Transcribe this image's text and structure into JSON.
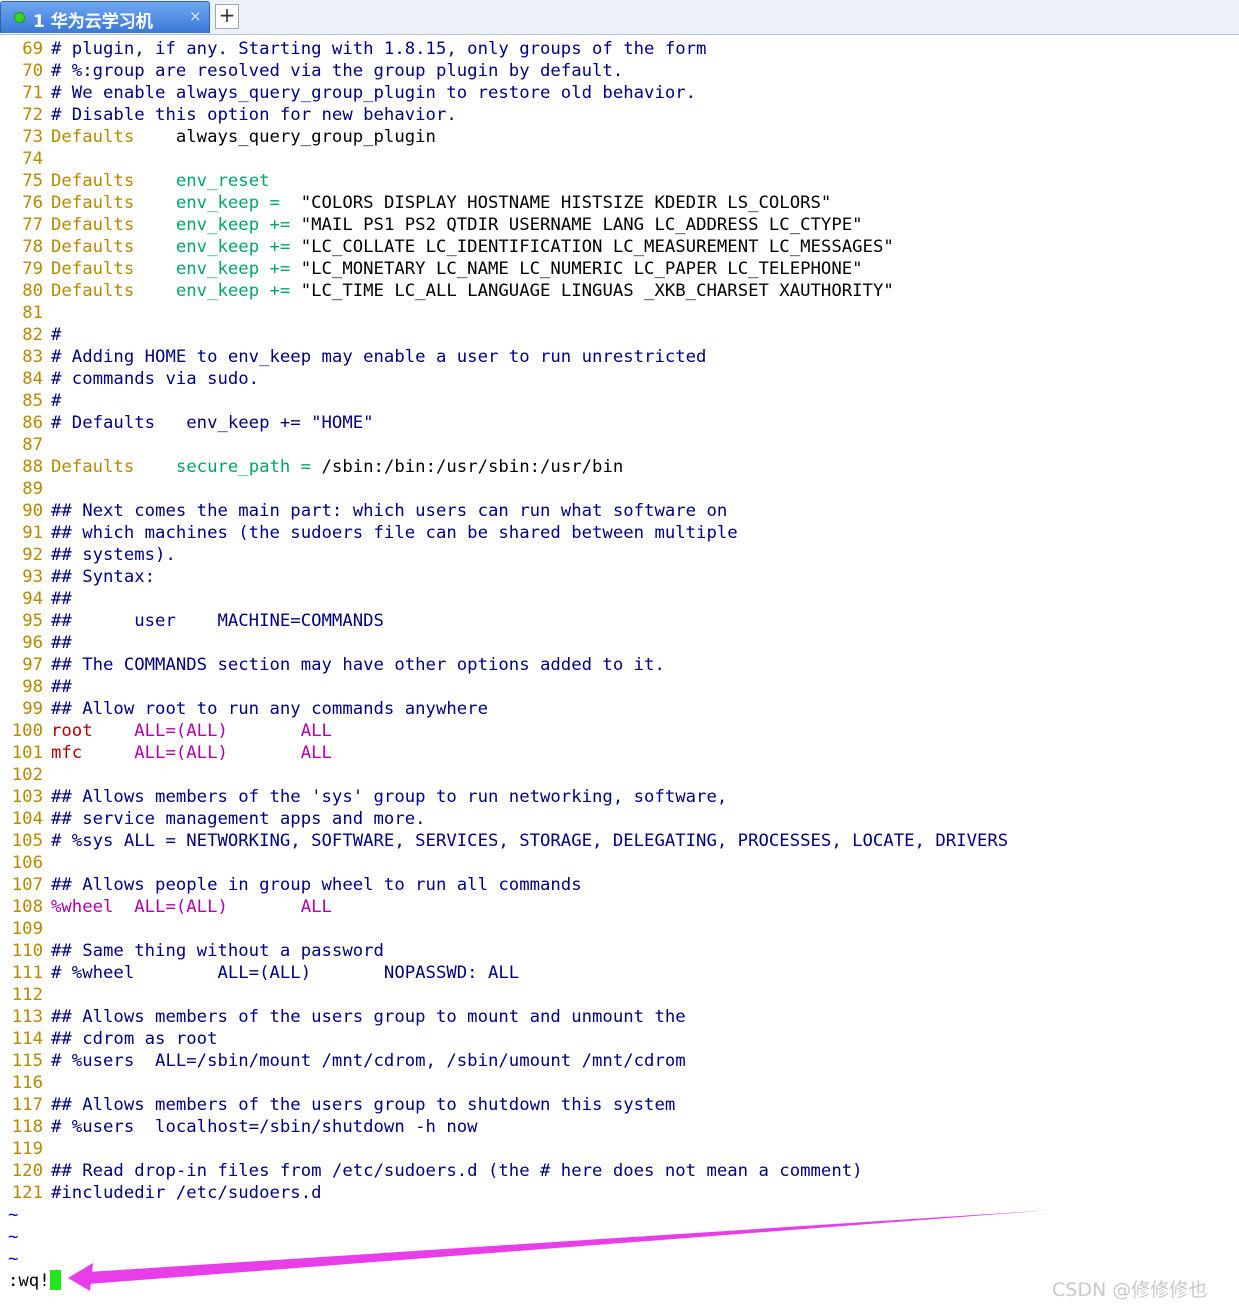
{
  "tab": {
    "title": "1 华为云学习机",
    "close_glyph": "×",
    "new_glyph": "+",
    "status_color": "#35d81f"
  },
  "editor": {
    "lines": [
      {
        "n": "69",
        "segs": [
          {
            "s": "c",
            "t": "# plugin, if any. Starting with 1.8.15, only groups of the form"
          }
        ]
      },
      {
        "n": "70",
        "segs": [
          {
            "s": "c",
            "t": "# %:group are resolved via the group plugin by default."
          }
        ]
      },
      {
        "n": "71",
        "segs": [
          {
            "s": "c",
            "t": "# We enable always_query_group_plugin to restore old behavior."
          }
        ]
      },
      {
        "n": "72",
        "segs": [
          {
            "s": "c",
            "t": "# Disable this option for new behavior."
          }
        ]
      },
      {
        "n": "73",
        "segs": [
          {
            "s": "k",
            "t": "Defaults"
          },
          {
            "s": "t",
            "t": "    always_query_group_plugin"
          }
        ]
      },
      {
        "n": "74",
        "segs": []
      },
      {
        "n": "75",
        "segs": [
          {
            "s": "k",
            "t": "Defaults"
          },
          {
            "s": "t",
            "t": "    "
          },
          {
            "s": "g",
            "t": "env_reset"
          }
        ]
      },
      {
        "n": "76",
        "segs": [
          {
            "s": "k",
            "t": "Defaults"
          },
          {
            "s": "t",
            "t": "    "
          },
          {
            "s": "g",
            "t": "env_keep =  "
          },
          {
            "s": "s",
            "t": "\"COLORS DISPLAY HOSTNAME HISTSIZE KDEDIR LS_COLORS\""
          }
        ]
      },
      {
        "n": "77",
        "segs": [
          {
            "s": "k",
            "t": "Defaults"
          },
          {
            "s": "t",
            "t": "    "
          },
          {
            "s": "g",
            "t": "env_keep += "
          },
          {
            "s": "s",
            "t": "\"MAIL PS1 PS2 QTDIR USERNAME LANG LC_ADDRESS LC_CTYPE\""
          }
        ]
      },
      {
        "n": "78",
        "segs": [
          {
            "s": "k",
            "t": "Defaults"
          },
          {
            "s": "t",
            "t": "    "
          },
          {
            "s": "g",
            "t": "env_keep += "
          },
          {
            "s": "s",
            "t": "\"LC_COLLATE LC_IDENTIFICATION LC_MEASUREMENT LC_MESSAGES\""
          }
        ]
      },
      {
        "n": "79",
        "segs": [
          {
            "s": "k",
            "t": "Defaults"
          },
          {
            "s": "t",
            "t": "    "
          },
          {
            "s": "g",
            "t": "env_keep += "
          },
          {
            "s": "s",
            "t": "\"LC_MONETARY LC_NAME LC_NUMERIC LC_PAPER LC_TELEPHONE\""
          }
        ]
      },
      {
        "n": "80",
        "segs": [
          {
            "s": "k",
            "t": "Defaults"
          },
          {
            "s": "t",
            "t": "    "
          },
          {
            "s": "g",
            "t": "env_keep += "
          },
          {
            "s": "s",
            "t": "\"LC_TIME LC_ALL LANGUAGE LINGUAS _XKB_CHARSET XAUTHORITY\""
          }
        ]
      },
      {
        "n": "81",
        "segs": []
      },
      {
        "n": "82",
        "segs": [
          {
            "s": "c",
            "t": "#"
          }
        ]
      },
      {
        "n": "83",
        "segs": [
          {
            "s": "c",
            "t": "# Adding HOME to env_keep may enable a user to run unrestricted"
          }
        ]
      },
      {
        "n": "84",
        "segs": [
          {
            "s": "c",
            "t": "# commands via sudo."
          }
        ]
      },
      {
        "n": "85",
        "segs": [
          {
            "s": "c",
            "t": "#"
          }
        ]
      },
      {
        "n": "86",
        "segs": [
          {
            "s": "c",
            "t": "# Defaults   env_keep += \"HOME\""
          }
        ]
      },
      {
        "n": "87",
        "segs": []
      },
      {
        "n": "88",
        "segs": [
          {
            "s": "k",
            "t": "Defaults"
          },
          {
            "s": "t",
            "t": "    "
          },
          {
            "s": "g",
            "t": "secure_path = "
          },
          {
            "s": "t",
            "t": "/sbin:/bin:/usr/sbin:/usr/bin"
          }
        ]
      },
      {
        "n": "89",
        "segs": []
      },
      {
        "n": "90",
        "segs": [
          {
            "s": "c",
            "t": "## Next comes the main part: which users can run what software on"
          }
        ]
      },
      {
        "n": "91",
        "segs": [
          {
            "s": "c",
            "t": "## which machines (the sudoers file can be shared between multiple"
          }
        ]
      },
      {
        "n": "92",
        "segs": [
          {
            "s": "c",
            "t": "## systems)."
          }
        ]
      },
      {
        "n": "93",
        "segs": [
          {
            "s": "c",
            "t": "## Syntax:"
          }
        ]
      },
      {
        "n": "94",
        "segs": [
          {
            "s": "c",
            "t": "##"
          }
        ]
      },
      {
        "n": "95",
        "segs": [
          {
            "s": "c",
            "t": "##      user    MACHINE=COMMANDS"
          }
        ]
      },
      {
        "n": "96",
        "segs": [
          {
            "s": "c",
            "t": "##"
          }
        ]
      },
      {
        "n": "97",
        "segs": [
          {
            "s": "c",
            "t": "## The COMMANDS section may have other options added to it."
          }
        ]
      },
      {
        "n": "98",
        "segs": [
          {
            "s": "c",
            "t": "##"
          }
        ]
      },
      {
        "n": "99",
        "segs": [
          {
            "s": "c",
            "t": "## Allow root to run any commands anywhere"
          }
        ]
      },
      {
        "n": "100",
        "segs": [
          {
            "s": "r",
            "t": "root"
          },
          {
            "s": "t",
            "t": "    "
          },
          {
            "s": "m",
            "t": "ALL=(ALL)"
          },
          {
            "s": "t",
            "t": "       "
          },
          {
            "s": "m",
            "t": "ALL"
          }
        ]
      },
      {
        "n": "101",
        "segs": [
          {
            "s": "r",
            "t": "mfc"
          },
          {
            "s": "t",
            "t": "     "
          },
          {
            "s": "m",
            "t": "ALL=(ALL)"
          },
          {
            "s": "t",
            "t": "       "
          },
          {
            "s": "m",
            "t": "ALL"
          }
        ]
      },
      {
        "n": "102",
        "segs": []
      },
      {
        "n": "103",
        "segs": [
          {
            "s": "c",
            "t": "## Allows members of the 'sys' group to run networking, software,"
          }
        ]
      },
      {
        "n": "104",
        "segs": [
          {
            "s": "c",
            "t": "## service management apps and more."
          }
        ]
      },
      {
        "n": "105",
        "segs": [
          {
            "s": "c",
            "t": "# %sys ALL = NETWORKING, SOFTWARE, SERVICES, STORAGE, DELEGATING, PROCESSES, LOCATE, DRIVERS"
          }
        ]
      },
      {
        "n": "106",
        "segs": []
      },
      {
        "n": "107",
        "segs": [
          {
            "s": "c",
            "t": "## Allows people in group wheel to run all commands"
          }
        ]
      },
      {
        "n": "108",
        "segs": [
          {
            "s": "m",
            "t": "%wheel"
          },
          {
            "s": "t",
            "t": "  "
          },
          {
            "s": "m",
            "t": "ALL=(ALL)"
          },
          {
            "s": "t",
            "t": "       "
          },
          {
            "s": "m",
            "t": "ALL"
          }
        ]
      },
      {
        "n": "109",
        "segs": []
      },
      {
        "n": "110",
        "segs": [
          {
            "s": "c",
            "t": "## Same thing without a password"
          }
        ]
      },
      {
        "n": "111",
        "segs": [
          {
            "s": "c",
            "t": "# %wheel        ALL=(ALL)       NOPASSWD: ALL"
          }
        ]
      },
      {
        "n": "112",
        "segs": []
      },
      {
        "n": "113",
        "segs": [
          {
            "s": "c",
            "t": "## Allows members of the users group to mount and unmount the"
          }
        ]
      },
      {
        "n": "114",
        "segs": [
          {
            "s": "c",
            "t": "## cdrom as root"
          }
        ]
      },
      {
        "n": "115",
        "segs": [
          {
            "s": "c",
            "t": "# %users  ALL=/sbin/mount /mnt/cdrom, /sbin/umount /mnt/cdrom"
          }
        ]
      },
      {
        "n": "116",
        "segs": []
      },
      {
        "n": "117",
        "segs": [
          {
            "s": "c",
            "t": "## Allows members of the users group to shutdown this system"
          }
        ]
      },
      {
        "n": "118",
        "segs": [
          {
            "s": "c",
            "t": "# %users  localhost=/sbin/shutdown -h now"
          }
        ]
      },
      {
        "n": "119",
        "segs": []
      },
      {
        "n": "120",
        "segs": [
          {
            "s": "c",
            "t": "## Read drop-in files from /etc/sudoers.d (the # here does not mean a comment)"
          }
        ]
      },
      {
        "n": "121",
        "segs": [
          {
            "s": "c",
            "t": "#includedir /etc/sudoers.d"
          }
        ]
      },
      {
        "n": "~",
        "segs": []
      },
      {
        "n": "~",
        "segs": []
      },
      {
        "n": "~",
        "segs": []
      }
    ]
  },
  "command_line": {
    "text": ":wq!",
    "cursor_color": "#22e61a"
  },
  "annotation": {
    "arrow_color": "#e83de8",
    "points_to": "command_line"
  },
  "watermark": "CSDN @修修修也"
}
